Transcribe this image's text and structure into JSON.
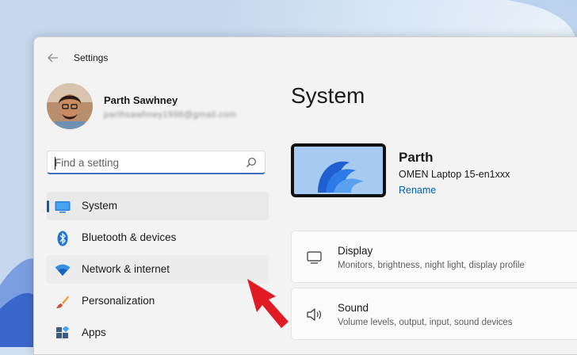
{
  "window": {
    "title": "Settings"
  },
  "user": {
    "name": "Parth Sawhney",
    "email": "parthsawhney1998@gmail.com"
  },
  "search": {
    "placeholder": "Find a setting",
    "value": ""
  },
  "nav": {
    "items": [
      {
        "label": "System",
        "icon": "system-icon",
        "selected": true
      },
      {
        "label": "Bluetooth & devices",
        "icon": "bluetooth-icon"
      },
      {
        "label": "Network & internet",
        "icon": "wifi-icon",
        "hover": true
      },
      {
        "label": "Personalization",
        "icon": "brush-icon"
      },
      {
        "label": "Apps",
        "icon": "apps-icon"
      }
    ]
  },
  "main": {
    "title": "System",
    "device": {
      "name": "Parth",
      "model": "OMEN Laptop 15-en1xxx",
      "rename_label": "Rename"
    },
    "cards": [
      {
        "title": "Display",
        "subtitle": "Monitors, brightness, night light, display profile",
        "icon": "monitor-icon"
      },
      {
        "title": "Sound",
        "subtitle": "Volume levels, output, input, sound devices",
        "icon": "speaker-icon"
      }
    ]
  },
  "colors": {
    "accent": "#005fb8",
    "annotation_arrow": "#e01b24"
  }
}
